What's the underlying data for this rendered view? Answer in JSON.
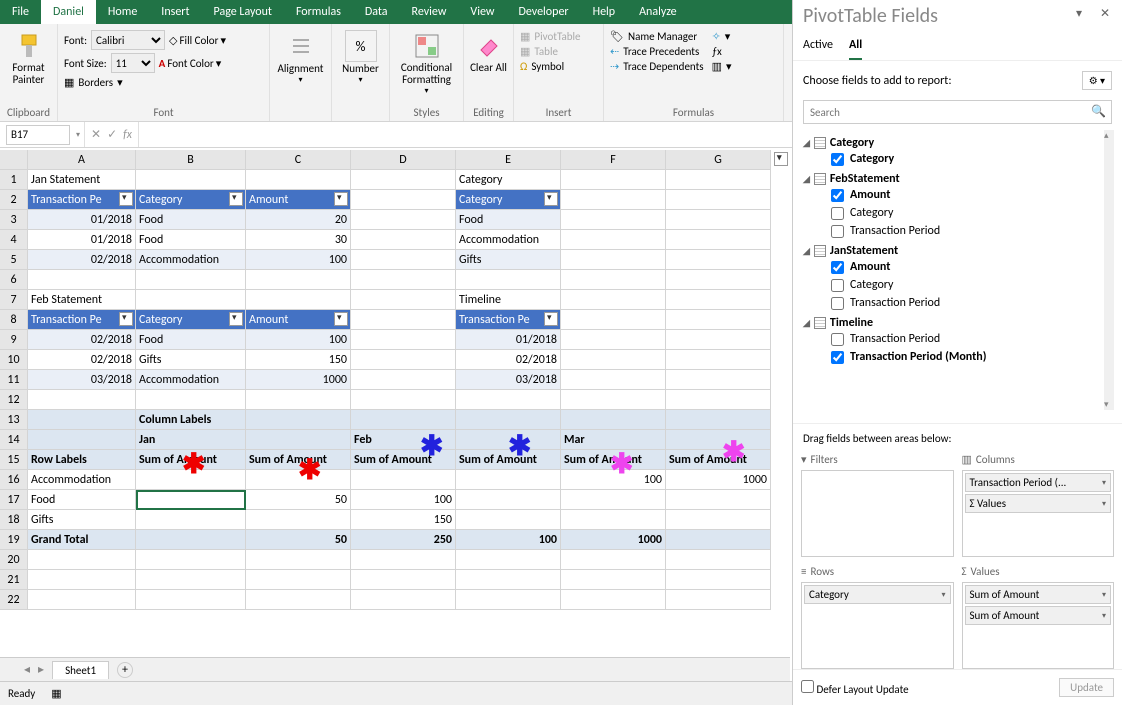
{
  "tabs": [
    "File",
    "Daniel",
    "Home",
    "Insert",
    "Page Layout",
    "Formulas",
    "Data",
    "Review",
    "View",
    "Developer",
    "Help",
    "Analyze"
  ],
  "active_tab": "Daniel",
  "ribbon": {
    "format_painter": "Format Painter",
    "clipboard_label": "Clipboard",
    "font_label_text": "Font:",
    "font_name": "Calibri",
    "font_size_label": "Font Size:",
    "font_size": "11",
    "fill_color": "Fill Color",
    "font_color": "Font Color",
    "borders": "Borders",
    "font_group": "Font",
    "alignment": "Alignment",
    "number": "Number",
    "cond_fmt": "Conditional Formatting",
    "styles": "Styles",
    "clear_all": "Clear All",
    "editing": "Editing",
    "pivottable": "PivotTable",
    "table": "Table",
    "symbol": "Symbol",
    "insert": "Insert",
    "name_mgr": "Name Manager",
    "trace_prec": "Trace Precedents",
    "trace_dep": "Trace Dependents",
    "formulas": "Formulas"
  },
  "name_box": "B17",
  "data": {
    "janTitle": "Jan Statement",
    "janHdr": [
      "Transaction Pe",
      "Category",
      "Amount"
    ],
    "janRows": [
      [
        "01/2018",
        "Food",
        "20"
      ],
      [
        "01/2018",
        "Food",
        "30"
      ],
      [
        "02/2018",
        "Accommodation",
        "100"
      ]
    ],
    "febTitle": "Feb Statement",
    "febHdr": [
      "Transaction Pe",
      "Category",
      "Amount"
    ],
    "febRows": [
      [
        "02/2018",
        "Food",
        "100"
      ],
      [
        "02/2018",
        "Gifts",
        "150"
      ],
      [
        "03/2018",
        "Accommodation",
        "1000"
      ]
    ],
    "catTitle": "Category",
    "catHdr": "Category",
    "cats": [
      "Food",
      "Accommodation",
      "Gifts"
    ],
    "tlTitle": "Timeline",
    "tlHdr": "Transaction Pe",
    "tl": [
      "01/2018",
      "02/2018",
      "03/2018"
    ],
    "pivot": {
      "colLabels": "Column Labels",
      "rowLabels": "Row Labels",
      "months": [
        "Jan",
        "Feb",
        "Mar"
      ],
      "sum_lbl": "Sum of Amount",
      "rows": [
        {
          "label": "Accommodation",
          "vals": [
            "",
            "",
            "",
            "",
            "100",
            "1000"
          ]
        },
        {
          "label": "Food",
          "vals": [
            "",
            "50",
            "100",
            "",
            "",
            ""
          ]
        },
        {
          "label": "Gifts",
          "vals": [
            "",
            "",
            "150",
            "",
            "",
            ""
          ]
        }
      ],
      "grand": {
        "label": "Grand Total",
        "vals": [
          "",
          "50",
          "250",
          "100",
          "1000",
          ""
        ]
      }
    }
  },
  "pane": {
    "title": "PivotTable Fields",
    "active": "Active",
    "all": "All",
    "choose": "Choose fields to add to report:",
    "search": "Search",
    "tables": [
      {
        "name": "Category",
        "fields": [
          {
            "label": "Category",
            "checked": true
          }
        ]
      },
      {
        "name": "FebStatement",
        "fields": [
          {
            "label": "Amount",
            "checked": true
          },
          {
            "label": "Category",
            "checked": false
          },
          {
            "label": "Transaction Period",
            "checked": false
          }
        ]
      },
      {
        "name": "JanStatement",
        "fields": [
          {
            "label": "Amount",
            "checked": true
          },
          {
            "label": "Category",
            "checked": false
          },
          {
            "label": "Transaction Period",
            "checked": false
          }
        ]
      },
      {
        "name": "Timeline",
        "fields": [
          {
            "label": "Transaction Period",
            "checked": false
          },
          {
            "label": "Transaction Period (Month)",
            "checked": true
          }
        ]
      }
    ],
    "drag": "Drag fields between areas below:",
    "filters": "Filters",
    "columns": "Columns",
    "rows": "Rows",
    "values": "Values",
    "col_pills": [
      "Transaction Period (...",
      "Σ  Values"
    ],
    "row_pills": [
      "Category"
    ],
    "val_pills": [
      "Sum of Amount",
      "Sum of Amount"
    ],
    "defer": "Defer Layout Update",
    "update": "Update"
  },
  "sheet_tab": "Sheet1",
  "status": "Ready"
}
